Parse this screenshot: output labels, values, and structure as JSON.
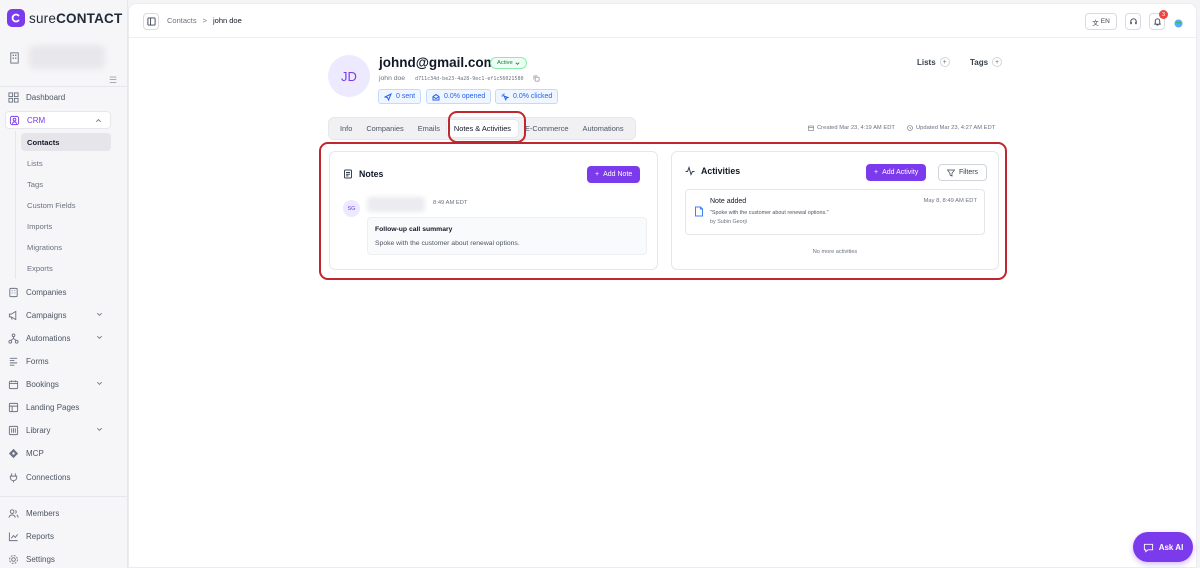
{
  "brand": {
    "sure": "sure",
    "contact": "CONTACT"
  },
  "sidebar": {
    "items": [
      {
        "label": "Dashboard",
        "icon": "dashboard-icon"
      },
      {
        "label": "CRM",
        "icon": "crm-icon"
      },
      {
        "label": "Companies",
        "icon": "building-icon"
      },
      {
        "label": "Campaigns",
        "icon": "megaphone-icon"
      },
      {
        "label": "Automations",
        "icon": "workflow-icon"
      },
      {
        "label": "Forms",
        "icon": "form-icon"
      },
      {
        "label": "Bookings",
        "icon": "calendar-icon"
      },
      {
        "label": "Landing Pages",
        "icon": "layout-icon"
      },
      {
        "label": "Library",
        "icon": "library-icon"
      },
      {
        "label": "MCP",
        "icon": "mcp-icon"
      },
      {
        "label": "Connections",
        "icon": "plug-icon"
      },
      {
        "label": "Members",
        "icon": "users-icon"
      },
      {
        "label": "Reports",
        "icon": "chart-icon"
      },
      {
        "label": "Settings",
        "icon": "gear-icon"
      }
    ],
    "crm_sub": [
      "Contacts",
      "Lists",
      "Tags",
      "Custom Fields",
      "Imports",
      "Migrations",
      "Exports"
    ]
  },
  "topbar": {
    "breadcrumb": {
      "parent": "Contacts",
      "separator": ">",
      "current": "john doe"
    },
    "language": "EN",
    "notification_count": "3"
  },
  "contact": {
    "initials": "JD",
    "email": "johnd@gmail.com",
    "status": "Active",
    "name": "john doe",
    "uuid": "d711c34d-be23-4a28-9ec1-ef1c56021580",
    "stats": {
      "sent": "0 sent",
      "opened": "0.0% opened",
      "clicked": "0.0% clicked"
    },
    "lists_label": "Lists",
    "tags_label": "Tags",
    "created": "Created Mar 23, 4:19 AM EDT",
    "updated": "Updated Mar 23, 4:27 AM EDT"
  },
  "tabs": [
    "Info",
    "Companies",
    "Emails",
    "Notes & Activities",
    "E-Commerce",
    "Automations"
  ],
  "active_tab": "Notes & Activities",
  "notes": {
    "title": "Notes",
    "add_label": "Add Note",
    "item": {
      "author_initials": "SG",
      "time": "8:49 AM EDT",
      "title": "Follow-up call summary",
      "body": "Spoke with the customer about renewal options."
    }
  },
  "activities": {
    "title": "Activities",
    "add_label": "Add Activity",
    "filters_label": "Filters",
    "item": {
      "title": "Note added",
      "quote": "\"Spoke with the customer about renewal options.\"",
      "by": "by Subin Georji",
      "date": "May 8, 8:49 AM EDT"
    },
    "empty_text": "No more activities"
  },
  "ask_ai_label": "Ask AI",
  "colors": {
    "accent": "#7c3aed",
    "highlight": "#c0262d",
    "active_status": "#15803d",
    "link_blue": "#2563eb"
  }
}
